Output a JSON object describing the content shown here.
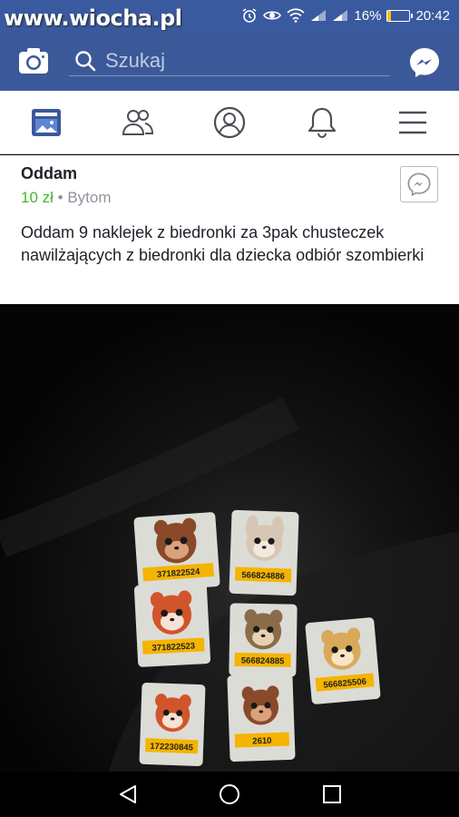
{
  "status_bar": {
    "watermark": "www.wiocha.pl",
    "battery_percent": "16%",
    "battery_level": 0.16,
    "time": "20:42",
    "icons": [
      "alarm-icon",
      "eye-icon",
      "wifi-icon",
      "signal-icon",
      "signal-icon",
      "battery-icon"
    ]
  },
  "header": {
    "search_placeholder": "Szukaj",
    "icons": [
      "camera-icon",
      "search-icon",
      "messenger-icon"
    ]
  },
  "nav": {
    "items": [
      "news-feed-icon",
      "friends-icon",
      "profile-icon",
      "notifications-icon",
      "menu-icon"
    ],
    "active": "news-feed-icon"
  },
  "post": {
    "title": "Oddam",
    "price": "10 zł",
    "separator": "•",
    "location": "Bytom",
    "body": "Oddam 9 naklejek z biedronki za 3pak chusteczek nawilżających z biedronki dla dziecka odbiór szombierki"
  },
  "photo": {
    "stickers": [
      {
        "number": "371822524",
        "animal": "bear"
      },
      {
        "number": "566824886",
        "animal": "bunny"
      },
      {
        "number": "371822523",
        "animal": "fox"
      },
      {
        "number": "566824885",
        "animal": "hedgehog"
      },
      {
        "number": "566825506",
        "animal": "lynx"
      },
      {
        "number": "172230845",
        "animal": "fox"
      },
      {
        "number": "2610",
        "animal": "bear"
      }
    ]
  },
  "colors": {
    "facebook_blue": "#3b5998",
    "price_green": "#42b72a",
    "sticker_label": "#f4b400"
  }
}
